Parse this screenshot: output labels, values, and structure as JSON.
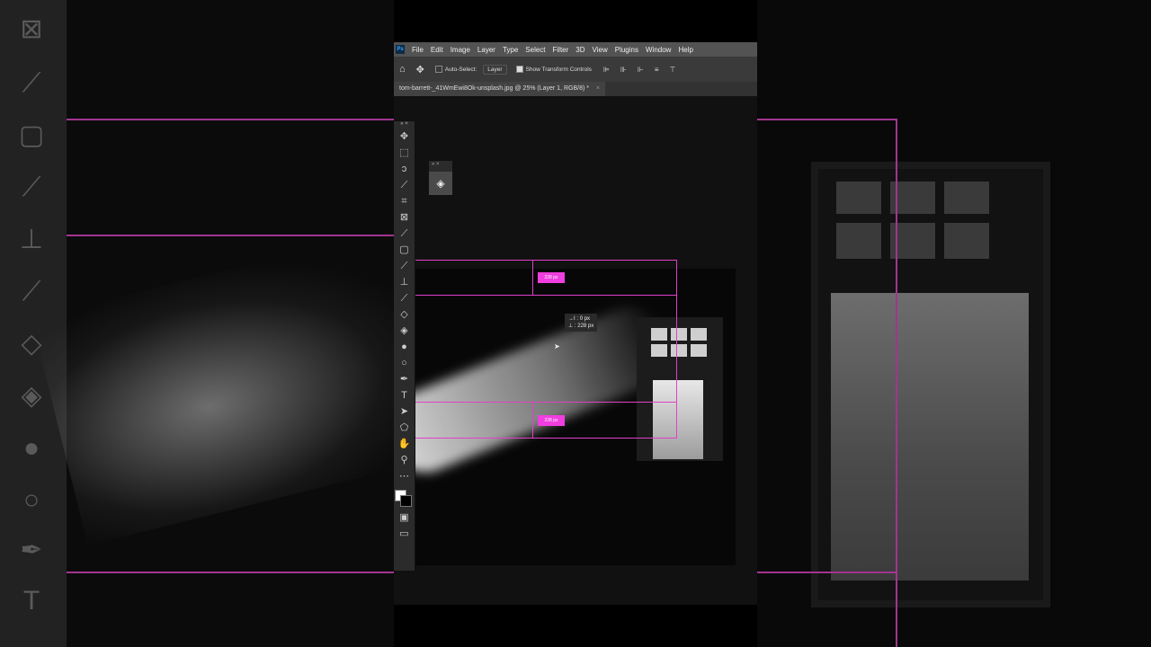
{
  "menu": {
    "app_badge": "Ps",
    "items": [
      "File",
      "Edit",
      "Image",
      "Layer",
      "Type",
      "Select",
      "Filter",
      "3D",
      "View",
      "Plugins",
      "Window",
      "Help"
    ]
  },
  "options_bar": {
    "auto_select_label": "Auto-Select:",
    "auto_select_checked": false,
    "target_value": "Layer",
    "show_transform_label": "Show Transform Controls",
    "show_transform_checked": true
  },
  "document": {
    "tab_title": "tom-barrett-_41WmEwi8Ok-unsplash.jpg @ 25% (Layer 1, RGB/8) *",
    "close_glyph": "×"
  },
  "measure": {
    "top_label": "228 px",
    "bottom_label": "228 px",
    "tip_x": "0 px",
    "tip_y": "228 px"
  },
  "icons": {
    "home": "home-icon",
    "move": "move-icon",
    "layers": "layers-icon"
  },
  "colors": {
    "guide": "#e040c8",
    "badge": "#f03ee0"
  }
}
